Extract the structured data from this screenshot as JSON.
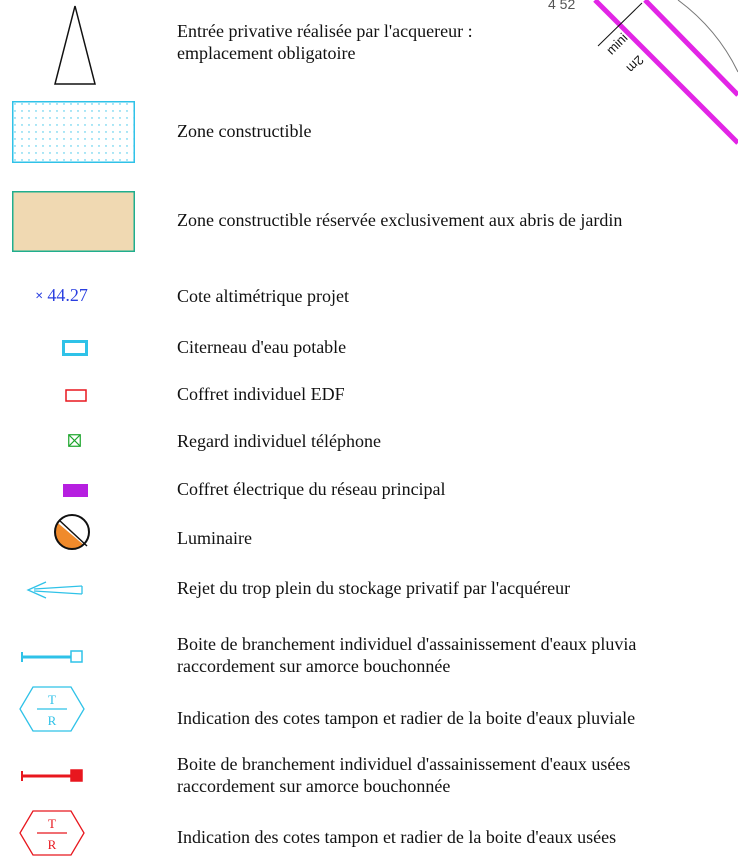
{
  "corner": {
    "dimension": "4 52",
    "setback_top": "mini",
    "setback_bottom": "2m"
  },
  "legend": [
    {
      "id": "entree",
      "symbol": "triangle-outline-icon",
      "text": [
        "Entrée privative réalisée par l'acquereur :",
        "emplacement obligatoire"
      ]
    },
    {
      "id": "zone-constructible",
      "symbol": "dotted-cyan-rect-icon",
      "text": [
        "Zone constructible"
      ]
    },
    {
      "id": "zone-abris",
      "symbol": "tan-rect-icon",
      "text": [
        "Zone constructible réservée  exclusivement  aux abris de jardin"
      ]
    },
    {
      "id": "cote",
      "symbol": "cote-marker-icon",
      "value": "44.27",
      "text": [
        "Cote altimétrique projet"
      ]
    },
    {
      "id": "citerneau",
      "symbol": "cyan-rect-outline-icon",
      "text": [
        "Citerneau d'eau potable"
      ]
    },
    {
      "id": "edf",
      "symbol": "red-rect-outline-icon",
      "text": [
        "Coffret individuel EDF"
      ]
    },
    {
      "id": "telephone",
      "symbol": "green-crossed-box-icon",
      "text": [
        "Regard individuel téléphone"
      ]
    },
    {
      "id": "electrique",
      "symbol": "magenta-filled-rect-icon",
      "text": [
        "Coffret électrique du réseau principal"
      ]
    },
    {
      "id": "luminaire",
      "symbol": "luminaire-circle-icon",
      "text": [
        "Luminaire"
      ]
    },
    {
      "id": "rejet",
      "symbol": "arrow-left-icon",
      "text": [
        "Rejet du trop plein du stockage privatif par l'acquéreur"
      ]
    },
    {
      "id": "boite-pluviales",
      "symbol": "cyan-pipe-box-icon",
      "text": [
        "Boite de branchement individuel d'assainissement d'eaux pluvia",
        "raccordement sur amorce bouchonnée"
      ]
    },
    {
      "id": "cotes-pluviales",
      "symbol": "cyan-hexagon-icon",
      "hex_top": "T",
      "hex_bottom": "R",
      "text": [
        "Indication des cotes tampon et radier de la boite d'eaux pluviale"
      ]
    },
    {
      "id": "boite-usees",
      "symbol": "red-pipe-box-icon",
      "text": [
        "Boite de branchement individuel d'assainissement d'eaux usées",
        "raccordement sur amorce bouchonnée"
      ]
    },
    {
      "id": "cotes-usees",
      "symbol": "red-hexagon-icon",
      "hex_top": "T",
      "hex_bottom": "R",
      "text": [
        "Indication des cotes tampon et radier de la boite d'eaux usées"
      ]
    }
  ],
  "colors": {
    "cyan": "#2fc2e8",
    "red": "#e8171e",
    "green": "#1aa52a",
    "magenta": "#b61fe0",
    "tan": "#f0d9b2",
    "orange": "#f08a2b",
    "blue": "#2a3fe0",
    "pink": "#e225e6"
  }
}
